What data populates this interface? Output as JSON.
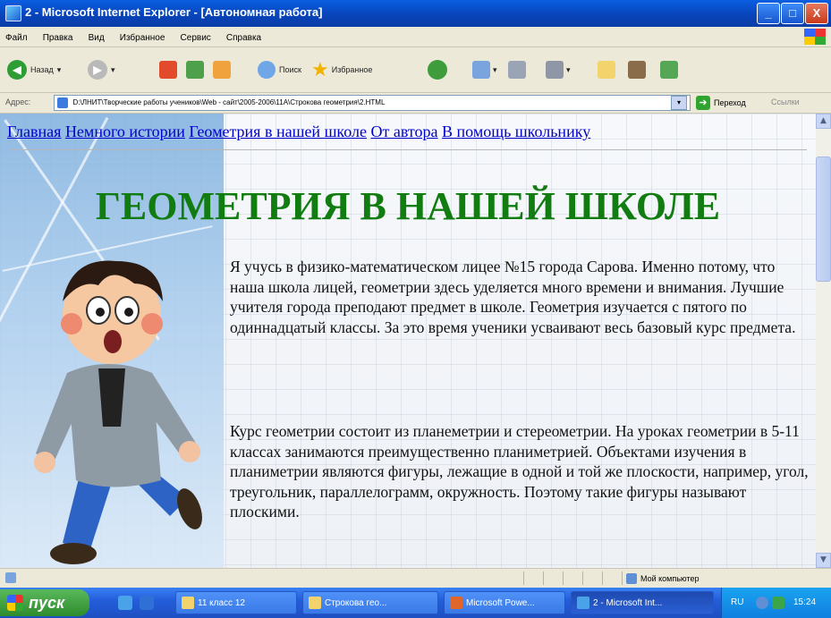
{
  "window": {
    "title": "2 - Microsoft Internet Explorer - [Автономная работа]",
    "buttons": {
      "minimize": "_",
      "maximize": "□",
      "close": "X"
    }
  },
  "menu": [
    "Файл",
    "Правка",
    "Вид",
    "Избранное",
    "Сервис",
    "Справка"
  ],
  "toolbar": {
    "back_label": "Назад",
    "search_label": "Поиск",
    "favorites_label": "Избранное"
  },
  "address": {
    "label": "Адрес:",
    "url": "D:\\ЛНИТ\\Творческие работы учеников\\Web - сайт\\2005-2006\\11А\\Строкова геометрия\\2.HTML",
    "go_label": "Переход",
    "links_label": "Ссылки"
  },
  "page": {
    "nav": [
      "Главная",
      "Немного истории",
      "Геометрия в нашей школе",
      "От автора",
      "В помощь школьнику"
    ],
    "heading": "ГЕОМЕТРИЯ В НАШЕЙ ШКОЛЕ",
    "paragraph1": "Я учусь в физико-математическом лицее №15 города Сарова. Именно потому, что наша школа лицей, геометрии здесь уделяется много времени и внимания. Лучшие учителя города преподают предмет в школе. Геометрия изучается с пятого по одиннадцатый классы. За это время ученики усваивают весь базовый курс предмета.",
    "paragraph2": "Курс геометрии состоит из планеметрии и стереометрии. На уроках геометрии в 5-11 классах занимаются преимущественно планиметрией. Объектами изучения в планиметрии являются фигуры, лежащие в одной и той же плоскости, например, угол, треугольник, параллелограмм, окружность. Поэтому такие фигуры называют плоскими."
  },
  "status": {
    "zone_label": "Мой компьютер"
  },
  "taskbar": {
    "start_label": "пуск",
    "tasks": [
      "11 класс 12",
      "Строкова гео...",
      "Microsoft Powe...",
      "2 - Microsoft Int..."
    ],
    "tray_lang": "RU",
    "clock": "15:24"
  },
  "colors": {
    "heading": "#117d11",
    "link": "#0000cc",
    "titlebar": "#0a5fe0"
  }
}
